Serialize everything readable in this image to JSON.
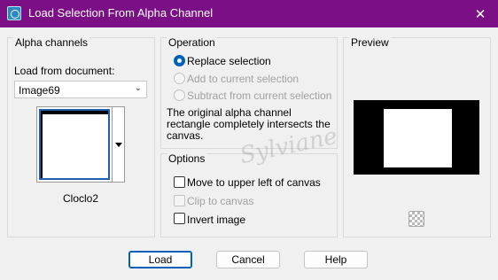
{
  "window": {
    "title": "Load Selection From Alpha Channel",
    "close_glyph": "✕",
    "titlebar_color": "#7a0f86"
  },
  "alpha_channels": {
    "legend": "Alpha channels",
    "load_from_label": "Load from document:",
    "document_value": "Image69",
    "channel_name": "Cloclo2"
  },
  "operation": {
    "legend": "Operation",
    "options": [
      {
        "label": "Replace selection",
        "checked": true,
        "enabled": true
      },
      {
        "label": "Add to current selection",
        "checked": false,
        "enabled": false
      },
      {
        "label": "Subtract from current selection",
        "checked": false,
        "enabled": false
      }
    ],
    "description": "The original alpha channel rectangle completely intersects the canvas."
  },
  "options": {
    "legend": "Options",
    "items": [
      {
        "label": "Move to upper left of canvas",
        "checked": false,
        "enabled": true
      },
      {
        "label": "Clip to canvas",
        "checked": false,
        "enabled": false
      },
      {
        "label": "Invert image",
        "checked": false,
        "enabled": true
      }
    ]
  },
  "preview": {
    "legend": "Preview",
    "icon": "checkerboard-icon"
  },
  "watermark": {
    "text": "Sylviane"
  },
  "buttons": {
    "load": "Load",
    "cancel": "Cancel",
    "help": "Help"
  }
}
